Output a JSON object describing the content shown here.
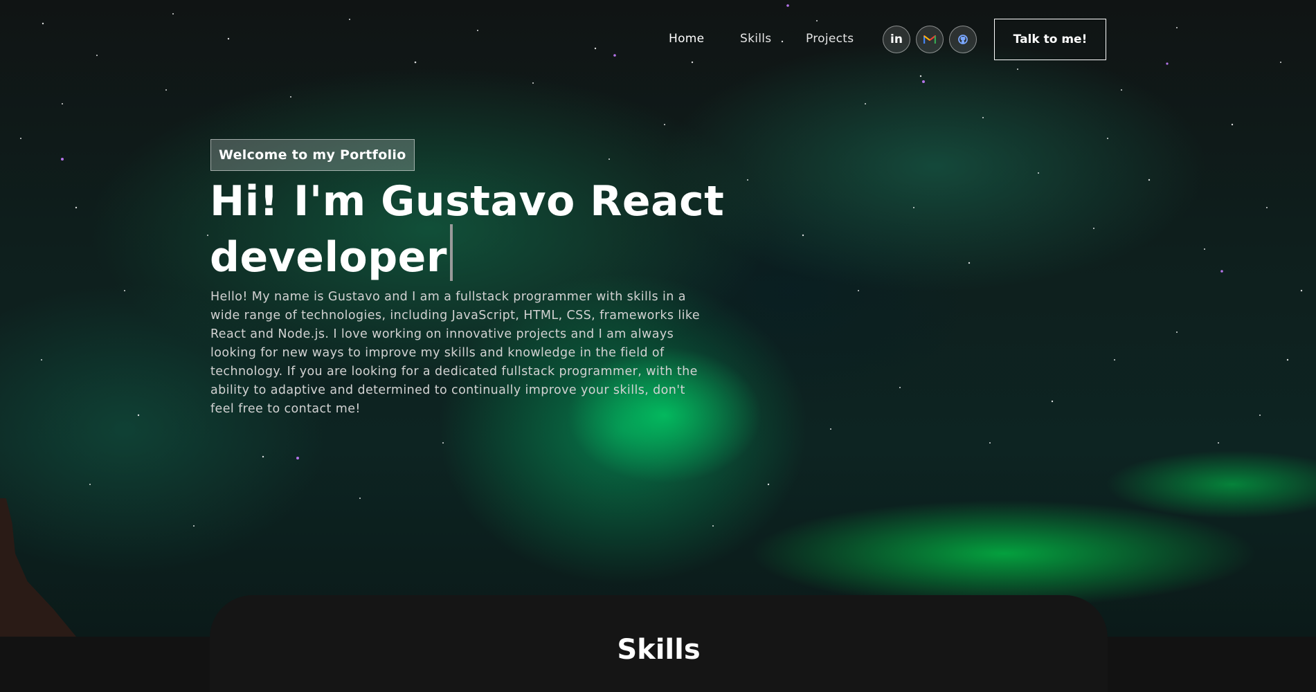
{
  "nav": {
    "links": [
      {
        "label": "Home",
        "active": true
      },
      {
        "label": "Skills",
        "active": false
      },
      {
        "label": "Projects",
        "active": false
      }
    ],
    "social": [
      {
        "icon": "linkedin-icon",
        "glyph": "in"
      },
      {
        "icon": "gmail-icon",
        "glyph": "M"
      },
      {
        "icon": "github-icon",
        "glyph": "github"
      }
    ],
    "cta_label": "Talk to me!"
  },
  "hero": {
    "tagline": "Welcome to my Portfolio",
    "headline_line1": "Hi! I'm Gustavo React",
    "headline_line2": "developer",
    "intro": "Hello! My name is Gustavo and I am a fullstack programmer with skills in a wide range of technologies, including JavaScript, HTML, CSS, frameworks like React and Node.js. I love working on innovative projects and I am always looking for new ways to improve my skills and knowledge in the field of technology. If you are looking for a dedicated fullstack programmer, with the ability to adaptive and determined to continually improve your skills, don't feel free to contact me!"
  },
  "skills": {
    "title": "Skills"
  },
  "colors": {
    "background": "#121212",
    "aurora": "#00e676",
    "text": "#ffffff"
  }
}
